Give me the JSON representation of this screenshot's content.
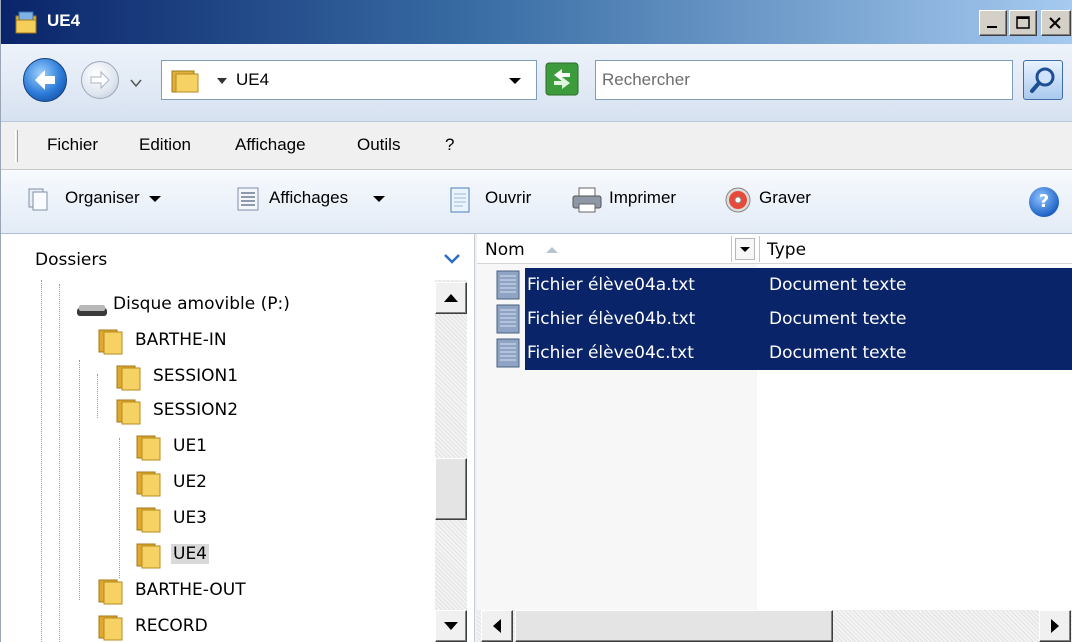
{
  "window": {
    "title": "UE4",
    "colors": {
      "selection": "#0a246a",
      "accent": "#3a6ea5"
    }
  },
  "address": {
    "path": "UE4",
    "search_placeholder": "Rechercher"
  },
  "menu": [
    "Fichier",
    "Edition",
    "Affichage",
    "Outils",
    "?"
  ],
  "toolbar": {
    "organiser": "Organiser",
    "affichages": "Affichages",
    "ouvrir": "Ouvrir",
    "imprimer": "Imprimer",
    "graver": "Graver",
    "help": "?"
  },
  "folders": {
    "title": "Dossiers",
    "items": [
      {
        "label": "Disque amovible (P:)",
        "icon": "drive-icon"
      },
      {
        "label": "BARTHE-IN",
        "icon": "folder-icon"
      },
      {
        "label": "SESSION1",
        "icon": "folder-icon"
      },
      {
        "label": "SESSION2",
        "icon": "folder-icon"
      },
      {
        "label": "UE1",
        "icon": "folder-icon"
      },
      {
        "label": "UE2",
        "icon": "folder-icon"
      },
      {
        "label": "UE3",
        "icon": "folder-icon"
      },
      {
        "label": "UE4",
        "icon": "folder-icon",
        "selected": true
      },
      {
        "label": "BARTHE-OUT",
        "icon": "folder-icon"
      },
      {
        "label": "RECORD",
        "icon": "folder-icon"
      }
    ]
  },
  "files": {
    "columns": [
      "Nom",
      "Type"
    ],
    "rows": [
      {
        "name": "Fichier élève04a.txt",
        "type": "Document texte",
        "selected": true
      },
      {
        "name": "Fichier élève04b.txt",
        "type": "Document texte",
        "selected": true
      },
      {
        "name": "Fichier élève04c.txt",
        "type": "Document texte",
        "selected": true
      }
    ]
  }
}
